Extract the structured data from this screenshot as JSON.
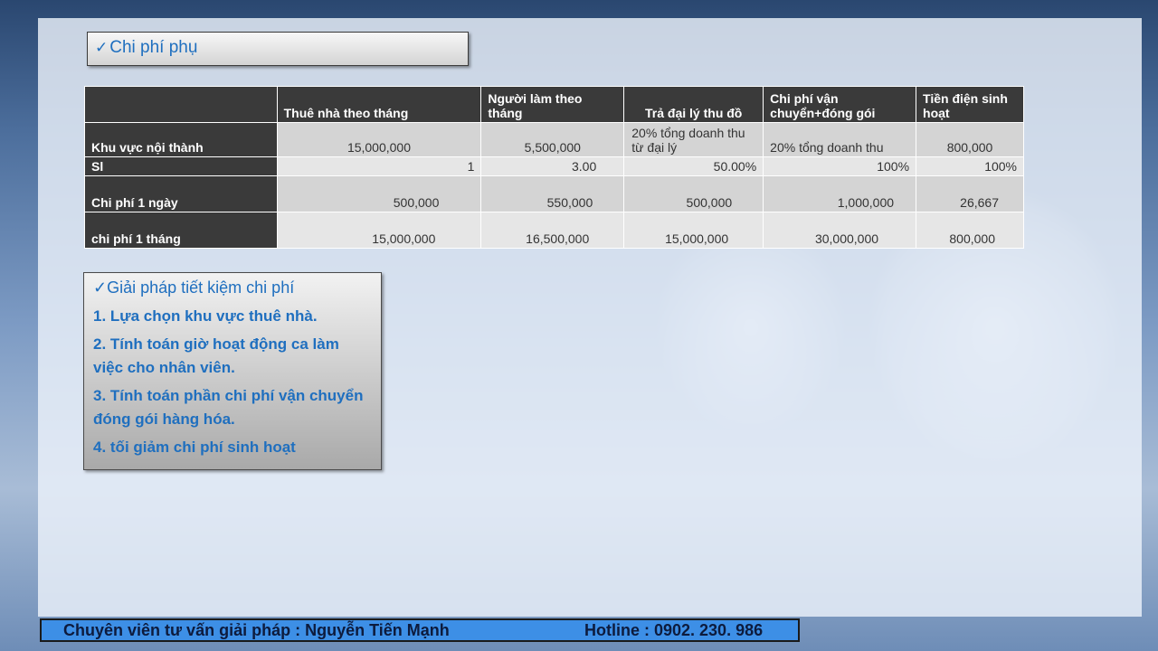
{
  "title": {
    "check": "✓",
    "text": "Chi phí  phụ"
  },
  "table": {
    "headers": [
      "",
      "Thuê nhà theo tháng",
      "Người làm theo tháng",
      "Trả đại lý thu đồ",
      "Chi phí vận chuyển+đóng gói",
      "Tiền điện sinh hoạt"
    ],
    "rows": [
      {
        "label": "Khu vực nội thành",
        "cells": [
          "15,000,000",
          "5,500,000",
          "20% tổng doanh thu từ đại lý",
          "20% tổng doanh thu",
          "800,000"
        ]
      },
      {
        "label": "Sl",
        "cells": [
          "1",
          "3.00",
          "50.00%",
          "100%",
          "100%"
        ]
      },
      {
        "label": "Chi phí 1 ngày",
        "cells": [
          "500,000",
          "550,000",
          "500,000",
          "1,000,000",
          "26,667"
        ]
      },
      {
        "label": "chi phí 1 tháng",
        "cells": [
          "15,000,000",
          "16,500,000",
          "15,000,000",
          "30,000,000",
          "800,000"
        ]
      }
    ]
  },
  "solutions": {
    "check": "✓",
    "title": "Giải pháp tiết kiệm chi phí",
    "items": [
      "1. Lựa chọn khu vực thuê nhà.",
      "2. Tính toán giờ hoạt động ca làm việc cho nhân viên.",
      "3. Tính toán phần chi phí vận chuyển đóng gói hàng hóa.",
      "4. tối giảm chi phí sinh hoạt"
    ]
  },
  "footer": {
    "advisor": "Chuyên viên tư vấn giải pháp : Nguyễn Tiến Mạnh",
    "hotline": "Hotline : 0902. 230. 986"
  },
  "colors": {
    "accent": "#1f6fbf",
    "header_bg": "#3a3a3a",
    "footer_bg": "#3d8fe6"
  }
}
